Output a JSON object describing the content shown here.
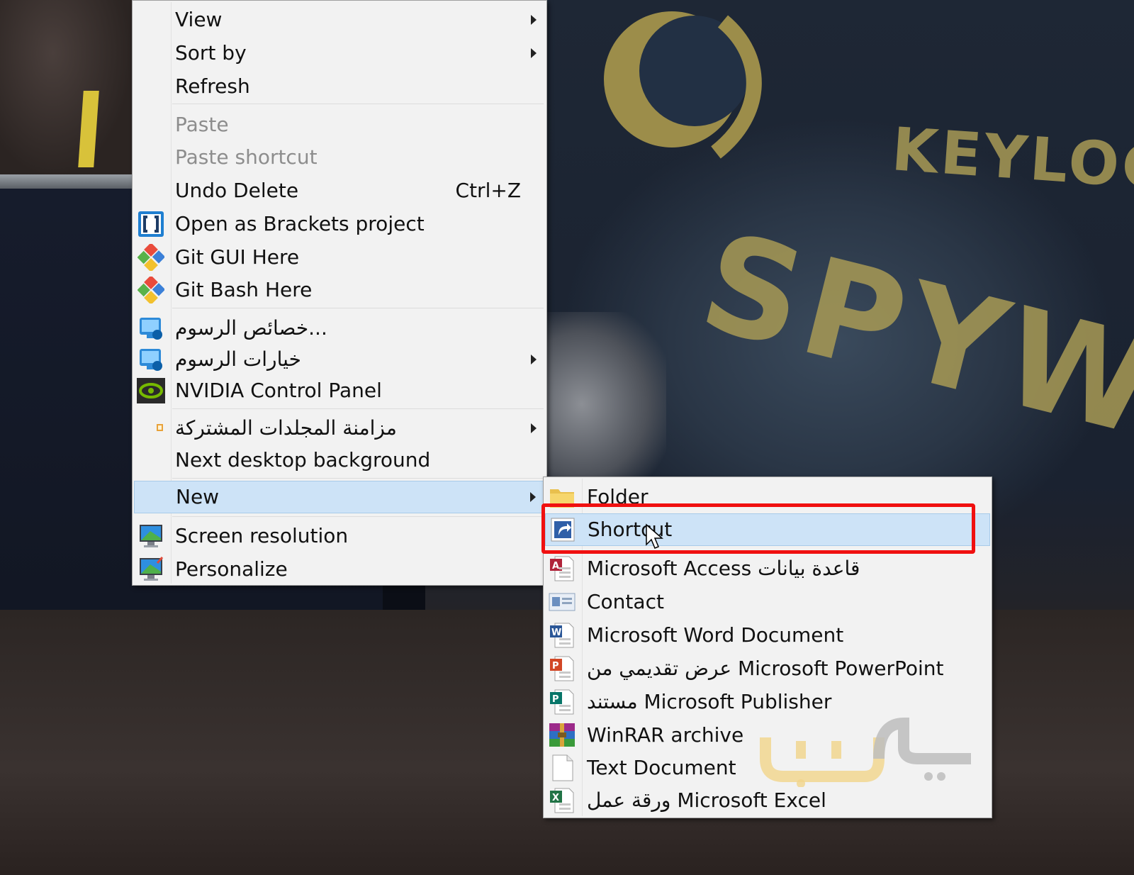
{
  "background": {
    "text_top": "KEYLOG",
    "text_big": "SPYWA"
  },
  "main_menu": {
    "items": [
      {
        "label": "View",
        "submenu": true
      },
      {
        "label": "Sort by",
        "submenu": true
      },
      {
        "label": "Refresh"
      },
      {
        "label": "Paste",
        "disabled": true
      },
      {
        "label": "Paste shortcut",
        "disabled": true
      },
      {
        "label": "Undo Delete",
        "shortcut": "Ctrl+Z"
      },
      {
        "label": "Open as Brackets project",
        "icon": "brackets-icon"
      },
      {
        "label": "Git GUI Here",
        "icon": "git-gui-icon"
      },
      {
        "label": "Git Bash Here",
        "icon": "git-bash-icon"
      },
      {
        "label": "خصائص الرسوم...",
        "icon": "intel-graphics-icon"
      },
      {
        "label": "خيارات الرسوم",
        "icon": "intel-graphics-icon",
        "submenu": true
      },
      {
        "label": "NVIDIA Control Panel",
        "icon": "nvidia-icon"
      },
      {
        "label": "مزامنة المجلدات المشتركة",
        "icon": "sync-icon",
        "submenu": true
      },
      {
        "label": "Next desktop background"
      },
      {
        "label": "New",
        "submenu": true,
        "selected": true
      },
      {
        "label": "Screen resolution",
        "icon": "monitor-icon"
      },
      {
        "label": "Personalize",
        "icon": "personalize-icon"
      }
    ]
  },
  "new_submenu": {
    "items": [
      {
        "label": "Folder",
        "icon": "folder-icon"
      },
      {
        "label": "Shortcut",
        "icon": "shortcut-icon",
        "selected": true
      },
      {
        "label": "Microsoft Access قاعدة بيانات",
        "icon": "access-icon"
      },
      {
        "label": "Contact",
        "icon": "contact-icon"
      },
      {
        "label": "Microsoft Word Document",
        "icon": "word-icon"
      },
      {
        "label": "عرض تقديمي من Microsoft PowerPoint",
        "icon": "powerpoint-icon"
      },
      {
        "label": "مستند Microsoft Publisher",
        "icon": "publisher-icon"
      },
      {
        "label": "WinRAR archive",
        "icon": "winrar-icon"
      },
      {
        "label": "Text Document",
        "icon": "text-document-icon"
      },
      {
        "label": "ورقة عمل Microsoft Excel",
        "icon": "excel-icon"
      }
    ]
  },
  "colors": {
    "menu_bg": "#f2f2f2",
    "selected_bg": "#cde3f7",
    "highlight_border": "#f01010"
  }
}
